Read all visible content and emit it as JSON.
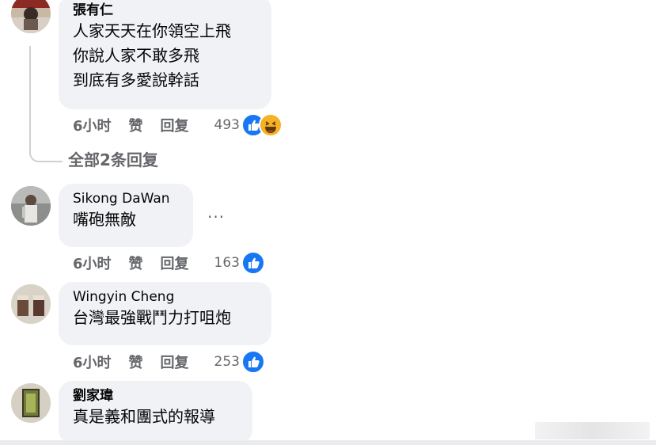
{
  "comments": [
    {
      "author": "張有仁",
      "lines": [
        "人家天天在你領空上飛",
        "你說人家不敢多飛",
        "到底有多愛說幹話"
      ],
      "time": "6小时",
      "like": "赞",
      "reply": "回复",
      "count": "493",
      "reactions": [
        "like-icon",
        "haha-icon"
      ],
      "replies_link": "全部2条回复"
    },
    {
      "author": "Sikong DaWan",
      "lines": [
        "嘴砲無敵"
      ],
      "time": "6小时",
      "like": "赞",
      "reply": "回复",
      "count": "163",
      "reactions": [
        "like-icon"
      ],
      "more": "···"
    },
    {
      "author": "Wingyin Cheng",
      "lines": [
        "台灣最強戰鬥力打咀炮"
      ],
      "time": "6小时",
      "like": "赞",
      "reply": "回复",
      "count": "253",
      "reactions": [
        "like-icon"
      ]
    },
    {
      "author": "劉家瑋",
      "lines": [
        "真是義和團式的報導"
      ]
    }
  ],
  "colors": {
    "like": "#1877f2",
    "haha": "#f7b125",
    "bubble": "#f0f2f5",
    "meta": "#65676b"
  }
}
